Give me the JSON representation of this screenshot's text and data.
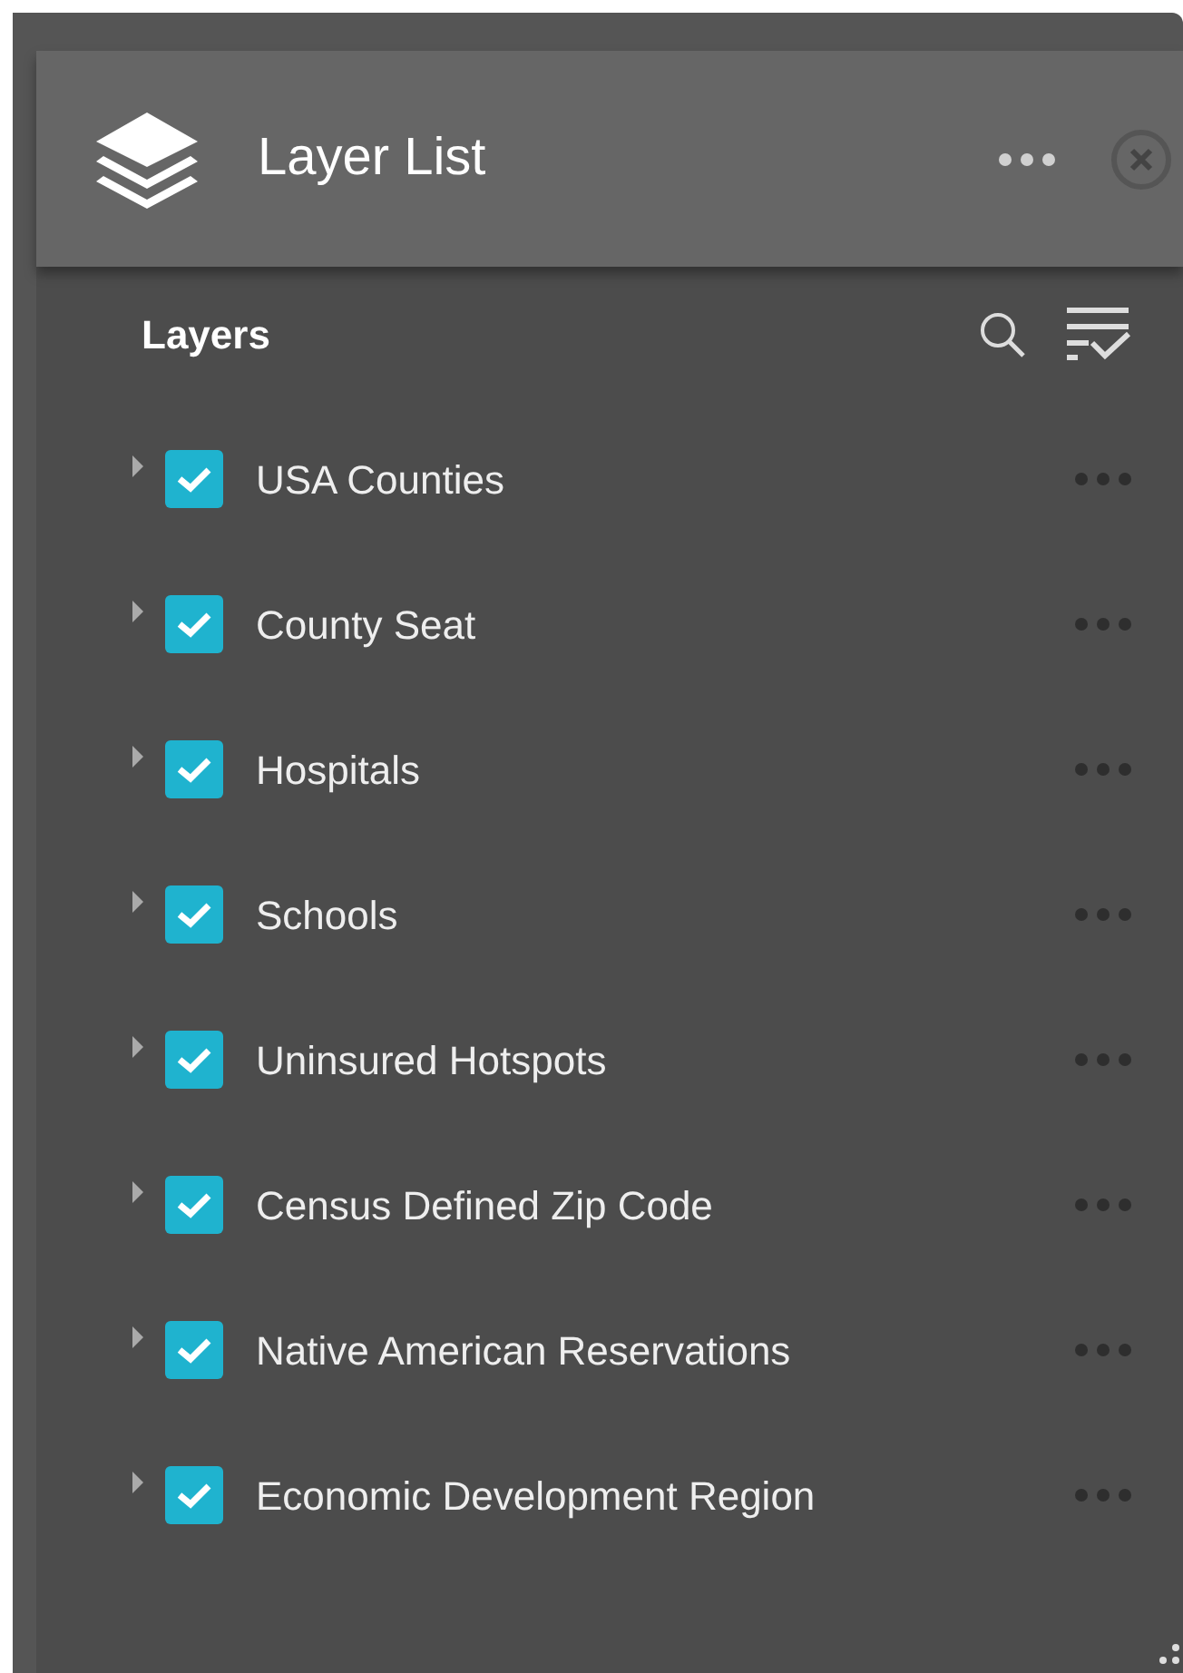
{
  "window": {
    "title": "Layer List"
  },
  "panel": {
    "title": "Layers"
  },
  "layers": [
    {
      "name": "USA Counties",
      "checked": true,
      "expanded": false
    },
    {
      "name": "County Seat",
      "checked": true,
      "expanded": false
    },
    {
      "name": "Hospitals",
      "checked": true,
      "expanded": false
    },
    {
      "name": "Schools",
      "checked": true,
      "expanded": false
    },
    {
      "name": "Uninsured Hotspots",
      "checked": true,
      "expanded": false
    },
    {
      "name": "Census Defined Zip Code",
      "checked": true,
      "expanded": false
    },
    {
      "name": "Native American Reservations",
      "checked": true,
      "expanded": false
    },
    {
      "name": "Economic Development Region",
      "checked": true,
      "expanded": false
    }
  ]
}
